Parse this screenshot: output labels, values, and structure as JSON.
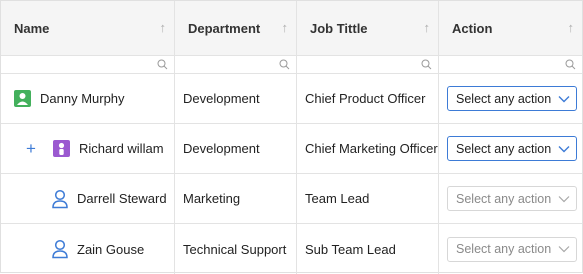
{
  "columns": [
    {
      "label": "Name"
    },
    {
      "label": "Department"
    },
    {
      "label": "Job Tittle"
    },
    {
      "label": "Action"
    }
  ],
  "sort_glyph": "↑",
  "rows": [
    {
      "name": "Danny Murphy",
      "department": "Development",
      "job_title": "Chief Product Officer",
      "action": "Select any action",
      "avatar": "green-person-icon",
      "expand": ""
    },
    {
      "name": "Richard willam",
      "department": "Development",
      "job_title": "Chief Marketing Officer",
      "action": "Select any action",
      "avatar": "purple-person-icon",
      "expand": "+"
    },
    {
      "name": "Darrell Steward",
      "department": "Marketing",
      "job_title": "Team Lead",
      "action": "Select any action",
      "avatar": "outline-person-icon",
      "expand": ""
    },
    {
      "name": "Zain Gouse",
      "department": "Technical Support",
      "job_title": "Sub Team Lead",
      "action": "Select any action",
      "avatar": "outline-person-icon",
      "expand": ""
    }
  ],
  "colors": {
    "accent": "#3d7bd6",
    "avatar_green": "#43b05c",
    "avatar_purple": "#9b59d0"
  }
}
